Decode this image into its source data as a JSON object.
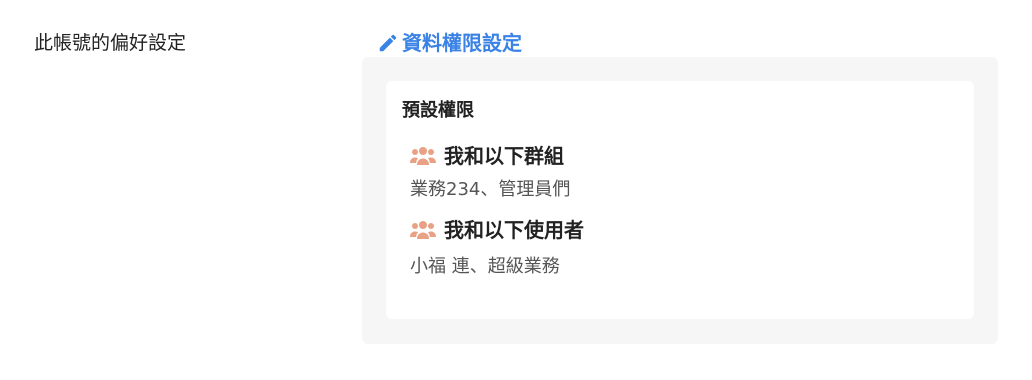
{
  "preferences": {
    "row_label": "此帳號的偏好設定",
    "edit_link_label": "資料權限設定",
    "edit_icon": "pencil-icon",
    "accent_color": "#3a82e6"
  },
  "permissions_card": {
    "title": "預設權限",
    "group_icon_color": "#e8a184",
    "sections": [
      {
        "icon": "users-icon",
        "heading": "我和以下群組",
        "values": "業務234、管理員們"
      },
      {
        "icon": "users-icon",
        "heading": "我和以下使用者",
        "values": "小福 連、超級業務"
      }
    ]
  }
}
